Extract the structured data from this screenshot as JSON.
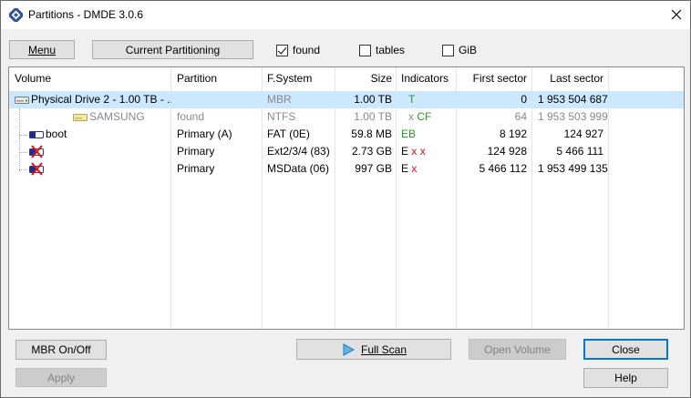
{
  "window": {
    "title": "Partitions - DMDE 3.0.6"
  },
  "toolbar": {
    "menu_label": "Menu",
    "current_partitioning_label": "Current Partitioning",
    "found_label": "found",
    "found_checked": true,
    "tables_label": "tables",
    "tables_checked": false,
    "gib_label": "GiB",
    "gib_checked": false
  },
  "table": {
    "columns": [
      "Volume",
      "Partition",
      "F.System",
      "Size",
      "Indicators",
      "First sector",
      "Last sector"
    ],
    "rows": [
      {
        "volume": "Physical Drive 2 - 1.00 TB - ...",
        "partition": "",
        "fsystem": "MBR",
        "size": "1.00 TB",
        "indicators": "T",
        "first": "0",
        "last": "1 953 504 687"
      },
      {
        "volume": "SAMSUNG",
        "partition": "found",
        "fsystem": "NTFS",
        "size": "1.00 TB",
        "ind_a": "x",
        "ind_b": "CF",
        "first": "64",
        "last": "1 953 503 999"
      },
      {
        "volume": "boot",
        "partition": "Primary (A)",
        "fsystem": "FAT (0E)",
        "size": "59.8 MB",
        "indicators": "EB",
        "first": "8 192",
        "last": "124 927"
      },
      {
        "volume": "",
        "partition": "Primary",
        "fsystem": "Ext2/3/4 (83)",
        "size": "2.73 GB",
        "ind_a": "E",
        "ind_b": "x x",
        "first": "124 928",
        "last": "5 466 111"
      },
      {
        "volume": "",
        "partition": "Primary",
        "fsystem": "MSData (06)",
        "size": "997 GB",
        "ind_a": "E",
        "ind_b": "x",
        "first": "5 466 112",
        "last": "1 953 499 135"
      }
    ]
  },
  "buttons": {
    "mbr_onoff": "MBR On/Off",
    "apply": "Apply",
    "full_scan": "Full Scan",
    "open_volume": "Open Volume",
    "close": "Close",
    "help": "Help"
  },
  "colors": {
    "selection": "#cce8ff",
    "accent": "#0078d7",
    "indicator_green": "#1f9d1f",
    "indicator_red": "#e01010"
  }
}
